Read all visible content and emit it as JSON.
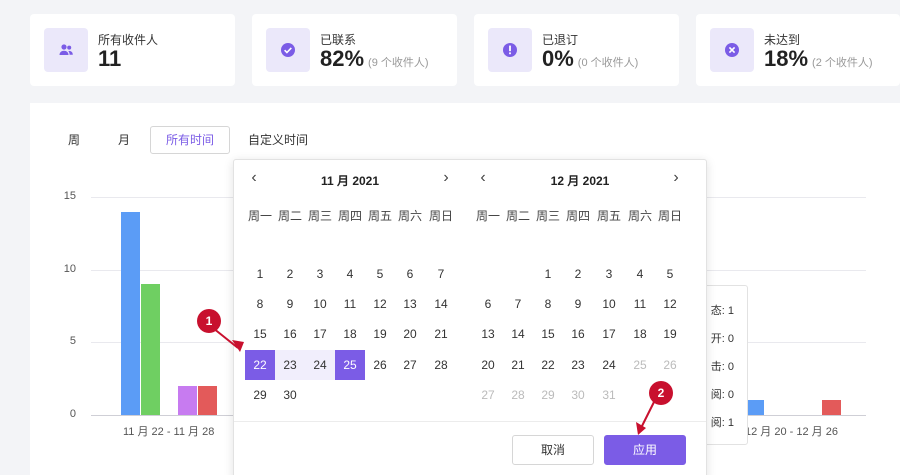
{
  "stats": [
    {
      "label": "所有收件人",
      "value": "11",
      "sub": "",
      "icon": "people-icon"
    },
    {
      "label": "已联系",
      "value": "82%",
      "sub": "(9 个收件人)",
      "icon": "check-circle-icon"
    },
    {
      "label": "已退订",
      "value": "0%",
      "sub": "(0 个收件人)",
      "icon": "exclamation-circle-icon"
    },
    {
      "label": "未达到",
      "value": "18%",
      "sub": "(2 个收件人)",
      "icon": "x-circle-icon"
    }
  ],
  "tabs": [
    "周",
    "月",
    "所有时间",
    "自定义时间"
  ],
  "active_tab": "所有时间",
  "chart_data": {
    "type": "bar",
    "categories": [
      "11 月 22 - 11 月 28",
      "12 月 20 - 12 月 26"
    ],
    "series": [
      {
        "color": "#5b9cf6",
        "values": [
          14,
          1
        ]
      },
      {
        "color": "#6fcf62",
        "values": [
          9,
          0
        ]
      },
      {
        "color": "#c77bf0",
        "values": [
          2,
          0
        ]
      },
      {
        "color": "#e35a5a",
        "values": [
          2,
          1
        ]
      }
    ],
    "yticks": [
      "15",
      "10",
      "5",
      "0"
    ],
    "ylim": [
      0,
      15
    ],
    "legend_partial": [
      "态: 1",
      "开: 0",
      "击: 0",
      "阅: 0",
      "阅: 1"
    ]
  },
  "calendar": {
    "weekdays": [
      "周一",
      "周二",
      "周三",
      "周四",
      "周五",
      "周六",
      "周日"
    ],
    "months": [
      {
        "title": "11 月 2021",
        "prev": "‹",
        "next": "›",
        "weeks": [
          [
            "1",
            "2",
            "3",
            "4",
            "5",
            "6",
            "7"
          ],
          [
            "8",
            "9",
            "10",
            "11",
            "12",
            "13",
            "14"
          ],
          [
            "15",
            "16",
            "17",
            "18",
            "19",
            "20",
            "21"
          ],
          [
            "22",
            "23",
            "24",
            "25",
            "26",
            "27",
            "28"
          ],
          [
            "29",
            "30",
            "",
            "",
            "",
            "",
            ""
          ]
        ]
      },
      {
        "title": "12 月 2021",
        "prev": "‹",
        "next": "›",
        "weeks": [
          [
            "",
            "",
            "1",
            "2",
            "3",
            "4",
            "5"
          ],
          [
            "6",
            "7",
            "8",
            "9",
            "10",
            "11",
            "12"
          ],
          [
            "13",
            "14",
            "15",
            "16",
            "17",
            "18",
            "19"
          ],
          [
            "20",
            "21",
            "22",
            "23",
            "24",
            "25",
            "26"
          ],
          [
            "27",
            "28",
            "29",
            "30",
            "31",
            "",
            ""
          ]
        ]
      }
    ],
    "range_start": "22",
    "range_end": "25",
    "cancel_label": "取消",
    "apply_label": "应用"
  },
  "markers": [
    "1",
    "2"
  ],
  "colors": {
    "accent": "#7b5ce6",
    "marker": "#c8102e"
  }
}
